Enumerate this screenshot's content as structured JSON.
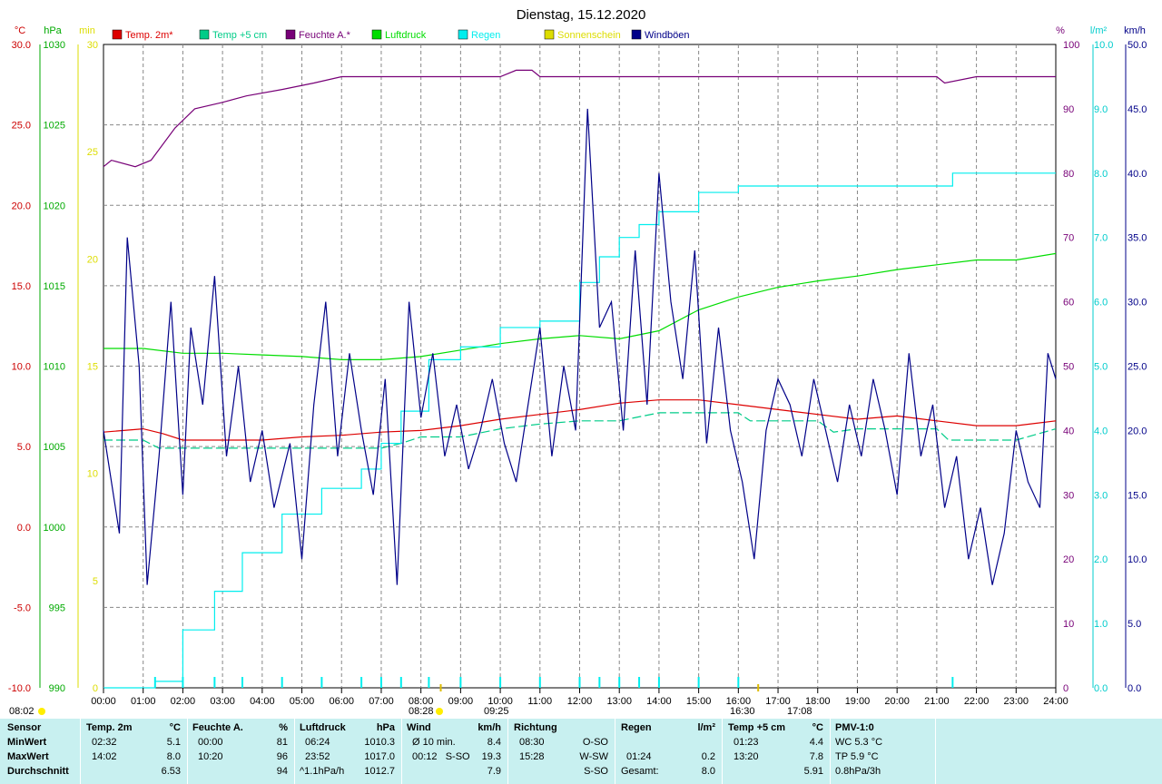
{
  "title": "Dienstag, 15.12.2020",
  "legend": [
    {
      "label": "Temp. 2m*",
      "color": "#dd0000"
    },
    {
      "label": "Temp +5 cm",
      "color": "#00cc88"
    },
    {
      "label": "Feuchte A.*",
      "color": "#770077"
    },
    {
      "label": "Luftdruck",
      "color": "#00dd00"
    },
    {
      "label": "Regen",
      "color": "#00eeee"
    },
    {
      "label": "Sonnenschein",
      "color": "#dddd00"
    },
    {
      "label": "Windböen",
      "color": "#000088"
    }
  ],
  "axis_units": {
    "temp": "°C",
    "pressure": "hPa",
    "sun": "min",
    "humidity": "%",
    "rain": "l/m²",
    "wind": "km/h"
  },
  "sun_events": {
    "sunrise": "08:02",
    "sunrise_chart": "08:28",
    "sunset": "16:30",
    "moon_a": "09:25",
    "moon_b": "17:08"
  },
  "chart_data": {
    "type": "line",
    "title": "Dienstag, 15.12.2020",
    "x_ticks": [
      "00:00",
      "01:00",
      "02:00",
      "03:00",
      "04:00",
      "05:00",
      "06:00",
      "07:00",
      "08:00",
      "09:00",
      "10:00",
      "11:00",
      "12:00",
      "13:00",
      "14:00",
      "15:00",
      "16:00",
      "17:00",
      "18:00",
      "19:00",
      "20:00",
      "21:00",
      "22:00",
      "23:00",
      "24:00"
    ],
    "axes": {
      "temp": {
        "unit": "°C",
        "range": [
          -10,
          30
        ],
        "ticks": [
          "30.0",
          "25.0",
          "20.0",
          "15.0",
          "10.0",
          "5.0",
          "0.0",
          "-5.0",
          "-10.0"
        ]
      },
      "pressure": {
        "unit": "hPa",
        "range": [
          990,
          1030
        ],
        "ticks": [
          "1030",
          "1025",
          "1020",
          "1015",
          "1010",
          "1005",
          "1000",
          "995",
          "990"
        ]
      },
      "sun": {
        "unit": "min",
        "range": [
          0,
          30
        ],
        "ticks": [
          "30",
          "25",
          "20",
          "15",
          "10",
          "5",
          "0"
        ]
      },
      "humidity": {
        "unit": "%",
        "range": [
          0,
          100
        ],
        "ticks": [
          "100",
          "90",
          "80",
          "70",
          "60",
          "50",
          "40",
          "30",
          "20",
          "10",
          "0"
        ]
      },
      "rain": {
        "unit": "l/m²",
        "range": [
          0,
          10
        ],
        "ticks": [
          "10.0",
          "9.0",
          "8.0",
          "7.0",
          "6.0",
          "5.0",
          "4.0",
          "3.0",
          "2.0",
          "1.0",
          "0.0"
        ]
      },
      "wind": {
        "unit": "km/h",
        "range": [
          0,
          50
        ],
        "ticks": [
          "50.0",
          "45.0",
          "40.0",
          "35.0",
          "30.0",
          "25.0",
          "20.0",
          "15.0",
          "10.0",
          "5.0",
          "0.0"
        ]
      }
    },
    "series": [
      {
        "name": "Temp. 2m*",
        "axis": "temp",
        "color": "#dd0000",
        "x": [
          0,
          1,
          1.5,
          2,
          3,
          4,
          5,
          6,
          7,
          8,
          9,
          10,
          11,
          12,
          13,
          14,
          15,
          16,
          17,
          18,
          19,
          20,
          21,
          22,
          23,
          24
        ],
        "y": [
          5.9,
          6.1,
          5.8,
          5.4,
          5.4,
          5.4,
          5.6,
          5.7,
          5.9,
          6.0,
          6.3,
          6.7,
          7.0,
          7.3,
          7.7,
          7.9,
          7.9,
          7.6,
          7.3,
          7.0,
          6.7,
          6.9,
          6.6,
          6.3,
          6.3,
          6.6
        ]
      },
      {
        "name": "Temp +5 cm",
        "axis": "temp",
        "color": "#00cc88",
        "x": [
          0,
          1,
          1.4,
          2,
          3,
          4,
          5,
          6,
          7,
          7.5,
          8,
          9,
          10,
          11,
          12,
          13,
          14,
          15,
          16,
          16.3,
          17,
          18,
          18.4,
          19,
          20,
          21,
          21.3,
          22,
          23,
          24
        ],
        "y": [
          5.4,
          5.4,
          4.9,
          4.9,
          4.9,
          4.9,
          4.9,
          4.9,
          4.9,
          5.2,
          5.6,
          5.6,
          6.1,
          6.4,
          6.6,
          6.6,
          7.1,
          7.1,
          7.1,
          6.6,
          6.6,
          6.6,
          5.9,
          6.1,
          6.1,
          6.1,
          5.4,
          5.4,
          5.4,
          6.1
        ]
      },
      {
        "name": "Feuchte A.*",
        "axis": "humidity",
        "color": "#770077",
        "x": [
          0,
          0.2,
          0.8,
          1.2,
          1.8,
          2.3,
          3.0,
          3.6,
          4.5,
          5.3,
          6.0,
          7,
          8,
          9,
          10,
          10.4,
          10.8,
          11,
          11.3,
          12,
          14,
          16,
          18,
          20,
          21,
          21.2,
          22,
          24
        ],
        "y": [
          81,
          82,
          81,
          82,
          87,
          90,
          91,
          92,
          93,
          94,
          95,
          95,
          95,
          95,
          95,
          96,
          96,
          95,
          95,
          95,
          95,
          95,
          95,
          95,
          95,
          94,
          95,
          95
        ]
      },
      {
        "name": "Luftdruck",
        "axis": "pressure",
        "color": "#00dd00",
        "x": [
          0,
          1,
          2,
          3,
          4,
          5,
          6,
          7,
          8,
          9,
          10,
          11,
          12,
          13,
          14,
          15,
          16,
          17,
          18,
          19,
          20,
          21,
          22,
          23,
          24
        ],
        "y": [
          1011.1,
          1011.1,
          1010.8,
          1010.8,
          1010.7,
          1010.6,
          1010.4,
          1010.4,
          1010.6,
          1011.0,
          1011.4,
          1011.7,
          1011.9,
          1011.7,
          1012.2,
          1013.5,
          1014.3,
          1014.9,
          1015.3,
          1015.6,
          1016.0,
          1016.3,
          1016.6,
          1016.6,
          1017.0
        ]
      },
      {
        "name": "Regen",
        "axis": "rain",
        "color": "#00eeee",
        "x": [
          0,
          1.3,
          2,
          2.8,
          3.5,
          4.5,
          5.5,
          6.5,
          7.0,
          7.5,
          8.2,
          9.0,
          10.0,
          11.0,
          12.0,
          12.5,
          13.0,
          13.5,
          14.0,
          15.0,
          16.0,
          17.0,
          18.0,
          19.0,
          20.0,
          21.3,
          21.4,
          24.0
        ],
        "y": [
          0,
          0.1,
          0.9,
          1.5,
          2.1,
          2.7,
          3.1,
          3.4,
          3.8,
          4.3,
          5.1,
          5.3,
          5.6,
          5.7,
          6.3,
          6.7,
          7.0,
          7.2,
          7.4,
          7.7,
          7.8,
          7.8,
          7.8,
          7.8,
          7.8,
          7.8,
          8.0,
          8.0
        ]
      },
      {
        "name": "Windböen",
        "axis": "wind",
        "color": "#000088",
        "x": [
          0,
          0.4,
          0.6,
          0.9,
          1.1,
          1.4,
          1.7,
          2.0,
          2.2,
          2.5,
          2.8,
          3.1,
          3.4,
          3.7,
          4.0,
          4.3,
          4.7,
          5.0,
          5.3,
          5.6,
          5.9,
          6.2,
          6.5,
          6.8,
          7.1,
          7.4,
          7.7,
          8.0,
          8.3,
          8.6,
          8.9,
          9.2,
          9.5,
          9.8,
          10.1,
          10.4,
          10.7,
          11.0,
          11.3,
          11.6,
          11.9,
          12.2,
          12.5,
          12.8,
          13.1,
          13.4,
          13.7,
          14.0,
          14.3,
          14.6,
          14.9,
          15.2,
          15.5,
          15.8,
          16.1,
          16.4,
          16.7,
          17.0,
          17.3,
          17.6,
          17.9,
          18.2,
          18.5,
          18.8,
          19.1,
          19.4,
          19.7,
          20.0,
          20.3,
          20.6,
          20.9,
          21.2,
          21.5,
          21.8,
          22.1,
          22.4,
          22.7,
          23.0,
          23.3,
          23.6,
          23.8,
          24.0
        ],
        "y": [
          20,
          12,
          35,
          25,
          8,
          18,
          30,
          15,
          28,
          22,
          32,
          18,
          25,
          16,
          20,
          14,
          19,
          10,
          22,
          30,
          18,
          26,
          20,
          15,
          24,
          8,
          30,
          21,
          26,
          18,
          22,
          17,
          20,
          24,
          19,
          16,
          22,
          28,
          18,
          25,
          20,
          45,
          28,
          30,
          20,
          34,
          22,
          40,
          30,
          24,
          34,
          19,
          28,
          20,
          16,
          10,
          20,
          24,
          22,
          18,
          24,
          20,
          16,
          22,
          18,
          24,
          20,
          15,
          26,
          18,
          22,
          14,
          18,
          10,
          14,
          8,
          12,
          20,
          16,
          14,
          26,
          24
        ]
      }
    ],
    "sun_ticks": [
      8.5,
      16.5
    ]
  },
  "stats": {
    "sensor": {
      "header": "Sensor",
      "rows": [
        "MinWert",
        "MaxWert",
        "Durchschnitt"
      ]
    },
    "temp2m": {
      "header": "Temp. 2m",
      "unit": "°C",
      "rows": [
        [
          "02:32",
          "5.1"
        ],
        [
          "14:02",
          "8.0"
        ],
        [
          "",
          "6.53"
        ]
      ]
    },
    "feuchte": {
      "header": "Feuchte A.",
      "unit": "%",
      "rows": [
        [
          "00:00",
          "81"
        ],
        [
          "10:20",
          "96"
        ],
        [
          "",
          "94"
        ]
      ]
    },
    "luftdruck": {
      "header": "Luftdruck",
      "unit": "hPa",
      "rows": [
        [
          "06:24",
          "1010.3"
        ],
        [
          "23:52",
          "1017.0"
        ],
        [
          "^1.1hPa/h",
          "1012.7"
        ]
      ]
    },
    "wind": {
      "header": "Wind",
      "unit": "km/h",
      "rows": [
        [
          "Ø 10 min.",
          "8.4"
        ],
        [
          "00:12   S-SO",
          "19.3"
        ],
        [
          "",
          "7.9"
        ]
      ]
    },
    "richtung": {
      "header": "Richtung",
      "rows": [
        [
          "08:30",
          "O-SO"
        ],
        [
          "15:28",
          "W-SW"
        ],
        [
          "",
          "S-SO"
        ]
      ]
    },
    "regen": {
      "header": "Regen",
      "unit": "l/m²",
      "rows": [
        [
          "",
          ""
        ],
        [
          "01:24",
          "0.2"
        ],
        [
          "Gesamt:",
          "8.0"
        ]
      ]
    },
    "temp5cm": {
      "header": "Temp +5 cm",
      "unit": "°C",
      "rows": [
        [
          "01:23",
          "4.4"
        ],
        [
          "13:20",
          "7.8"
        ],
        [
          "",
          "5.91"
        ]
      ]
    },
    "pmv": {
      "header": "PMV-1:0",
      "rows": [
        "WC 5.3 °C",
        "TP 5.9 °C",
        "0.8hPa/3h"
      ]
    }
  }
}
